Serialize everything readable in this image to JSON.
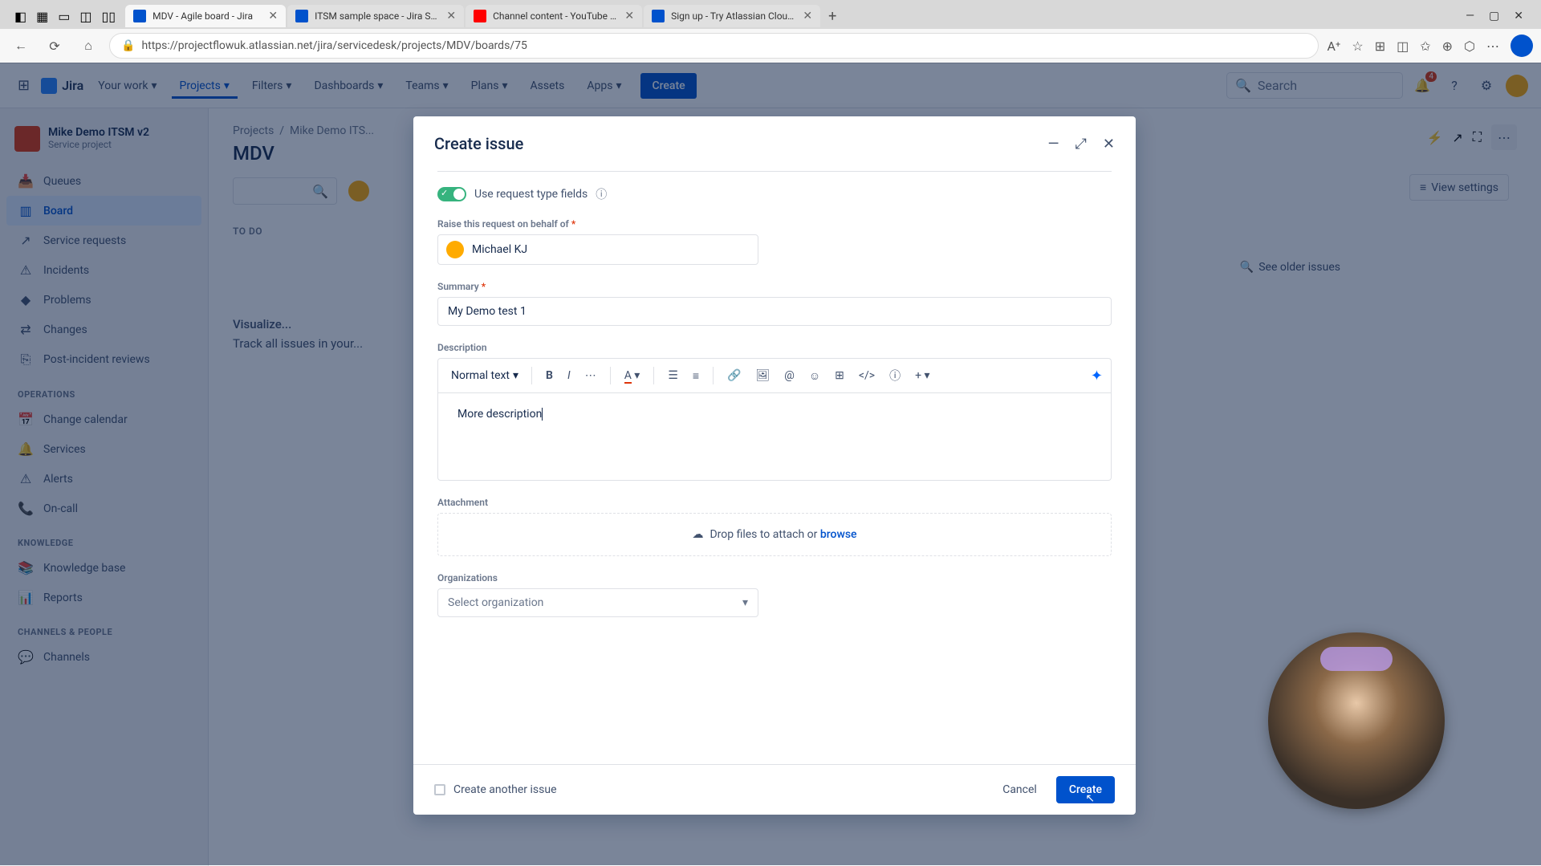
{
  "browser": {
    "tabs": [
      {
        "title": "MDV - Agile board - Jira",
        "active": true,
        "favicon": "jira"
      },
      {
        "title": "ITSM sample space - Jira Service",
        "favicon": "jira"
      },
      {
        "title": "Channel content - YouTube Studio",
        "favicon": "yt"
      },
      {
        "title": "Sign up - Try Atlassian Cloud | At",
        "favicon": "atl"
      }
    ],
    "url": "https://projectflowuk.atlassian.net/jira/servicedesk/projects/MDV/boards/75"
  },
  "jiraNav": {
    "product": "Jira",
    "items": [
      "Your work",
      "Projects",
      "Filters",
      "Dashboards",
      "Teams",
      "Plans",
      "Assets",
      "Apps"
    ],
    "activeIndex": 1,
    "createLabel": "Create",
    "searchPlaceholder": "Search",
    "notifCount": "4"
  },
  "sidebar": {
    "project": {
      "name": "Mike Demo ITSM v2",
      "type": "Service project"
    },
    "main": [
      {
        "icon": "📥",
        "label": "Queues"
      },
      {
        "icon": "▥",
        "label": "Board",
        "selected": true
      },
      {
        "icon": "↗",
        "label": "Service requests"
      },
      {
        "icon": "⚠",
        "label": "Incidents"
      },
      {
        "icon": "◆",
        "label": "Problems"
      },
      {
        "icon": "⇄",
        "label": "Changes"
      },
      {
        "icon": "⎘",
        "label": "Post-incident reviews"
      }
    ],
    "section1": "OPERATIONS",
    "ops": [
      {
        "icon": "📅",
        "label": "Change calendar"
      },
      {
        "icon": "🔔",
        "label": "Services"
      },
      {
        "icon": "⚠",
        "label": "Alerts"
      },
      {
        "icon": "📞",
        "label": "On-call"
      }
    ],
    "section2": "KNOWLEDGE",
    "knowledge": [
      {
        "icon": "📚",
        "label": "Knowledge base"
      },
      {
        "icon": "📊",
        "label": "Reports"
      }
    ],
    "section3": "CHANNELS & PEOPLE",
    "channels": [
      {
        "icon": "💬",
        "label": "Channels"
      }
    ]
  },
  "board": {
    "breadcrumb": {
      "a": "Projects",
      "b": "Mike Demo ITS..."
    },
    "title": "MDV",
    "column": "TO DO",
    "viewSettings": "View settings",
    "seeOlder": "See older issues",
    "emptyTitle": "Visualize...",
    "emptyText": "Track all issues in your..."
  },
  "modal": {
    "title": "Create issue",
    "toggleLabel": "Use request type fields",
    "behalfLabel": "Raise this request on behalf of",
    "behalfValue": "Michael KJ",
    "summaryLabel": "Summary",
    "summaryValue": "My Demo test 1",
    "descLabel": "Description",
    "textStyle": "Normal text",
    "descValue": "More description",
    "attachLabel": "Attachment",
    "dropText": "Drop files to attach or ",
    "browse": "browse",
    "orgLabel": "Organizations",
    "orgPlaceholder": "Select organization",
    "createAnother": "Create another issue",
    "cancel": "Cancel",
    "create": "Create"
  }
}
